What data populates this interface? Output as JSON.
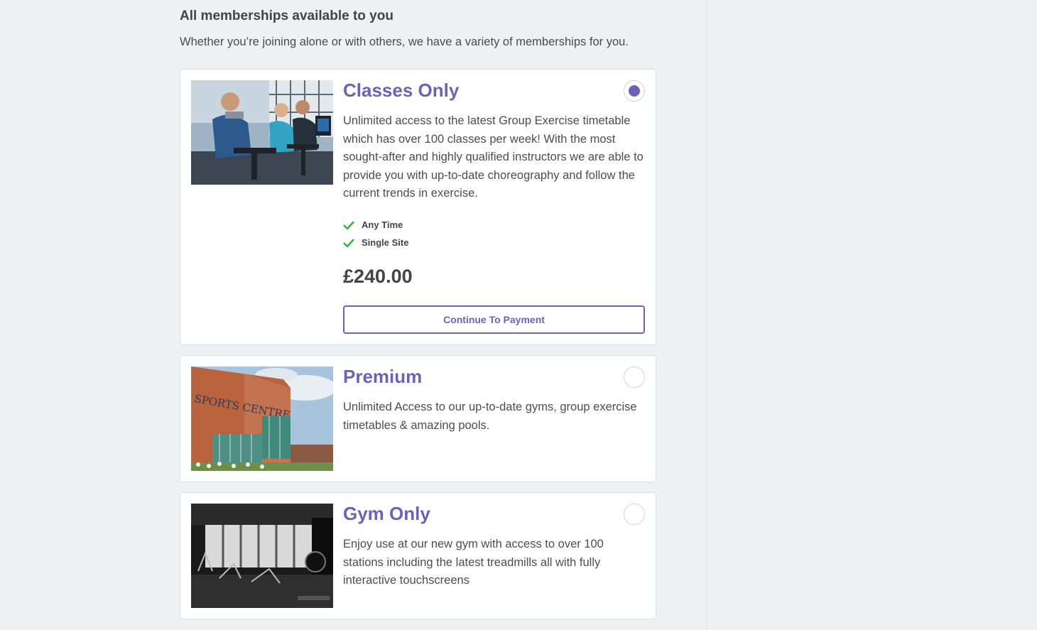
{
  "section": {
    "title": "All memberships available to you",
    "subtitle": "Whether you’re joining alone or with others, we have a variety of memberships for you."
  },
  "memberships": [
    {
      "title": "Classes Only",
      "description": "Unlimited access to the latest Group Exercise timetable which has over 100 classes per week! With the most sought-after and highly qualified instructors we are able to provide you with up-to-date choreography and follow the current trends in exercise.",
      "features": [
        "Any Time",
        "Single Site"
      ],
      "price": "£240.00",
      "cta": "Continue To Payment",
      "selected": true,
      "image": "spin-class-photo"
    },
    {
      "title": "Premium",
      "description": "Unlimited Access to our up-to-date gyms, group exercise timetables & amazing pools.",
      "selected": false,
      "image": "sports-centre-building-photo",
      "image_sign": "SPORTS CENTRE"
    },
    {
      "title": "Gym Only",
      "description": "Enjoy use at our new gym with access to over 100 stations including the latest treadmills all with fully interactive touchscreens",
      "selected": false,
      "image": "gym-floor-photo"
    }
  ],
  "colors": {
    "accent": "#6a63b8",
    "check": "#3cb043",
    "background": "#eef1f4",
    "card": "#ffffff"
  }
}
